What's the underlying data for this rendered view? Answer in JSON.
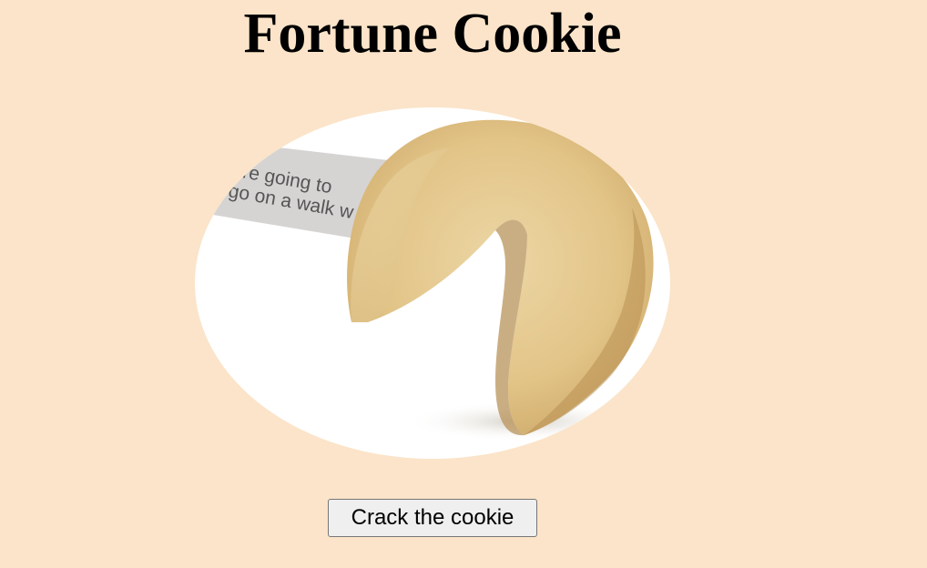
{
  "page": {
    "title": "Fortune Cookie",
    "background_color": "#fbe4c9"
  },
  "image": {
    "name": "fortune-cookie-image",
    "fortune_line_1": "are going to",
    "fortune_line_2": "go on a walk w"
  },
  "actions": {
    "crack_label": "Crack the cookie"
  }
}
